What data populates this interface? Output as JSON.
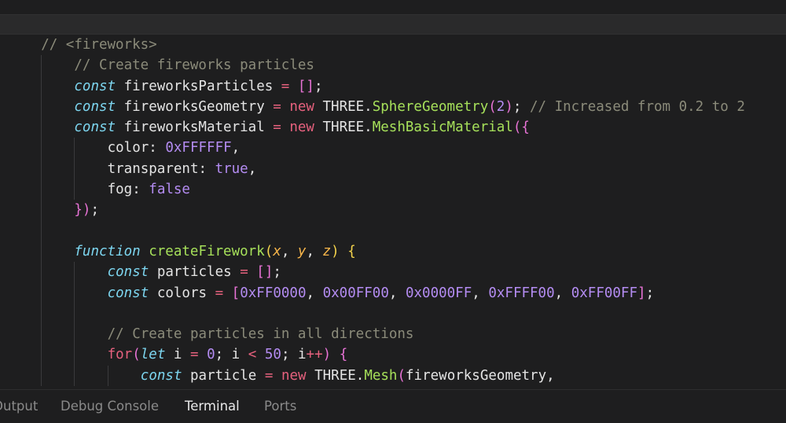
{
  "editor": {
    "lines": [
      {
        "indent": 1,
        "tokens": [
          {
            "t": "// <fireworks>",
            "c": "comment"
          }
        ]
      },
      {
        "indent": 2,
        "tokens": [
          {
            "t": "// Create fireworks particles",
            "c": "comment"
          }
        ]
      },
      {
        "indent": 2,
        "tokens": [
          {
            "t": "const",
            "c": "storage"
          },
          {
            "t": " fireworksParticles ",
            "c": "text"
          },
          {
            "t": "=",
            "c": "op"
          },
          {
            "t": " ",
            "c": "text"
          },
          {
            "t": "[]",
            "c": "bracket"
          },
          {
            "t": ";",
            "c": "punc"
          }
        ]
      },
      {
        "indent": 2,
        "tokens": [
          {
            "t": "const",
            "c": "storage"
          },
          {
            "t": " fireworksGeometry ",
            "c": "text"
          },
          {
            "t": "=",
            "c": "op"
          },
          {
            "t": " ",
            "c": "text"
          },
          {
            "t": "new",
            "c": "keyword"
          },
          {
            "t": " THREE.",
            "c": "text"
          },
          {
            "t": "SphereGeometry",
            "c": "type"
          },
          {
            "t": "(",
            "c": "bracket"
          },
          {
            "t": "2",
            "c": "num"
          },
          {
            "t": ")",
            "c": "bracket"
          },
          {
            "t": "; ",
            "c": "punc"
          },
          {
            "t": "// Increased from 0.2 to 2",
            "c": "comment"
          }
        ]
      },
      {
        "indent": 2,
        "tokens": [
          {
            "t": "const",
            "c": "storage"
          },
          {
            "t": " fireworksMaterial ",
            "c": "text"
          },
          {
            "t": "=",
            "c": "op"
          },
          {
            "t": " ",
            "c": "text"
          },
          {
            "t": "new",
            "c": "keyword"
          },
          {
            "t": " THREE.",
            "c": "text"
          },
          {
            "t": "MeshBasicMaterial",
            "c": "type"
          },
          {
            "t": "({",
            "c": "bracket"
          }
        ]
      },
      {
        "indent": 3,
        "tokens": [
          {
            "t": "color: ",
            "c": "text"
          },
          {
            "t": "0xFFFFFF",
            "c": "num"
          },
          {
            "t": ",",
            "c": "punc"
          }
        ]
      },
      {
        "indent": 3,
        "tokens": [
          {
            "t": "transparent: ",
            "c": "text"
          },
          {
            "t": "true",
            "c": "bool"
          },
          {
            "t": ",",
            "c": "punc"
          }
        ]
      },
      {
        "indent": 3,
        "tokens": [
          {
            "t": "fog: ",
            "c": "text"
          },
          {
            "t": "false",
            "c": "bool"
          }
        ]
      },
      {
        "indent": 2,
        "tokens": [
          {
            "t": "})",
            "c": "bracket"
          },
          {
            "t": ";",
            "c": "punc"
          }
        ]
      },
      {
        "indent": 2,
        "tokens": []
      },
      {
        "indent": 2,
        "tokens": [
          {
            "t": "function",
            "c": "storage"
          },
          {
            "t": " ",
            "c": "text"
          },
          {
            "t": "createFirework",
            "c": "fn"
          },
          {
            "t": "(",
            "c": "brace-y"
          },
          {
            "t": "x",
            "c": "param"
          },
          {
            "t": ", ",
            "c": "punc"
          },
          {
            "t": "y",
            "c": "param"
          },
          {
            "t": ", ",
            "c": "punc"
          },
          {
            "t": "z",
            "c": "param"
          },
          {
            "t": ")",
            "c": "brace-y"
          },
          {
            "t": " ",
            "c": "text"
          },
          {
            "t": "{",
            "c": "brace-y"
          }
        ]
      },
      {
        "indent": 3,
        "tokens": [
          {
            "t": "const",
            "c": "storage"
          },
          {
            "t": " particles ",
            "c": "text"
          },
          {
            "t": "=",
            "c": "op"
          },
          {
            "t": " ",
            "c": "text"
          },
          {
            "t": "[]",
            "c": "bracket"
          },
          {
            "t": ";",
            "c": "punc"
          }
        ]
      },
      {
        "indent": 3,
        "tokens": [
          {
            "t": "const",
            "c": "storage"
          },
          {
            "t": " colors ",
            "c": "text"
          },
          {
            "t": "=",
            "c": "op"
          },
          {
            "t": " ",
            "c": "text"
          },
          {
            "t": "[",
            "c": "bracket"
          },
          {
            "t": "0xFF0000",
            "c": "num"
          },
          {
            "t": ", ",
            "c": "punc"
          },
          {
            "t": "0x00FF00",
            "c": "num"
          },
          {
            "t": ", ",
            "c": "punc"
          },
          {
            "t": "0x0000FF",
            "c": "num"
          },
          {
            "t": ", ",
            "c": "punc"
          },
          {
            "t": "0xFFFF00",
            "c": "num"
          },
          {
            "t": ", ",
            "c": "punc"
          },
          {
            "t": "0xFF00FF",
            "c": "num"
          },
          {
            "t": "]",
            "c": "bracket"
          },
          {
            "t": ";",
            "c": "punc"
          }
        ]
      },
      {
        "indent": 3,
        "tokens": []
      },
      {
        "indent": 3,
        "tokens": [
          {
            "t": "// Create particles in all directions",
            "c": "comment"
          }
        ]
      },
      {
        "indent": 3,
        "tokens": [
          {
            "t": "for",
            "c": "keyword"
          },
          {
            "t": "(",
            "c": "bracket"
          },
          {
            "t": "let",
            "c": "storage"
          },
          {
            "t": " i ",
            "c": "text"
          },
          {
            "t": "=",
            "c": "op"
          },
          {
            "t": " ",
            "c": "text"
          },
          {
            "t": "0",
            "c": "num"
          },
          {
            "t": "; i ",
            "c": "text"
          },
          {
            "t": "<",
            "c": "op"
          },
          {
            "t": " ",
            "c": "text"
          },
          {
            "t": "50",
            "c": "num"
          },
          {
            "t": "; i",
            "c": "text"
          },
          {
            "t": "++",
            "c": "op"
          },
          {
            "t": ")",
            "c": "bracket"
          },
          {
            "t": " ",
            "c": "text"
          },
          {
            "t": "{",
            "c": "bracket"
          }
        ]
      },
      {
        "indent": 4,
        "tokens": [
          {
            "t": "const",
            "c": "storage"
          },
          {
            "t": " particle ",
            "c": "text"
          },
          {
            "t": "=",
            "c": "op"
          },
          {
            "t": " ",
            "c": "text"
          },
          {
            "t": "new",
            "c": "keyword"
          },
          {
            "t": " THREE.",
            "c": "text"
          },
          {
            "t": "Mesh",
            "c": "type"
          },
          {
            "t": "(",
            "c": "bracket"
          },
          {
            "t": "fireworksGeometry,",
            "c": "text"
          }
        ]
      }
    ]
  },
  "panel": {
    "tabs": [
      {
        "label": "Output",
        "active": false
      },
      {
        "label": "Debug Console",
        "active": false
      },
      {
        "label": "Terminal",
        "active": true
      },
      {
        "label": "Ports",
        "active": false
      }
    ]
  }
}
